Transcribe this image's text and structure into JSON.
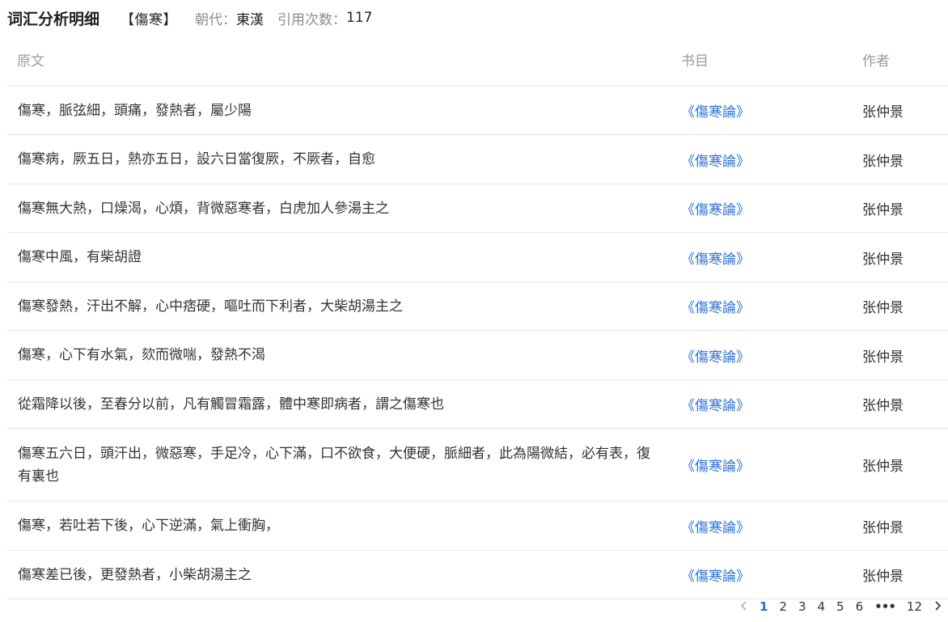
{
  "header": {
    "title": "词汇分析明细",
    "word": "【傷寒】",
    "dynasty_label": "朝代：",
    "dynasty_value": "東漢",
    "citations_label": "引用次数：",
    "citations_value": "117"
  },
  "table": {
    "columns": [
      "原文",
      "书目",
      "作者"
    ],
    "rows": [
      {
        "text": "傷寒，脈弦細，頭痛，發熱者，屬少陽",
        "book": "《傷寒論》",
        "author": "张仲景"
      },
      {
        "text": "傷寒病，厥五日，熱亦五日，設六日當復厥，不厥者，自愈",
        "book": "《傷寒論》",
        "author": "张仲景"
      },
      {
        "text": "傷寒無大熱，口燥渴，心煩，背微惡寒者，白虎加人參湯主之",
        "book": "《傷寒論》",
        "author": "张仲景"
      },
      {
        "text": "傷寒中風，有柴胡證",
        "book": "《傷寒論》",
        "author": "张仲景"
      },
      {
        "text": "傷寒發熱，汗出不解，心中痞硬，嘔吐而下利者，大柴胡湯主之",
        "book": "《傷寒論》",
        "author": "张仲景"
      },
      {
        "text": "傷寒，心下有水氣，欬而微喘，發熱不渴",
        "book": "《傷寒論》",
        "author": "张仲景"
      },
      {
        "text": "從霜降以後，至春分以前，凡有觸冒霜露，體中寒即病者，謂之傷寒也",
        "book": "《傷寒論》",
        "author": "张仲景"
      },
      {
        "text": "傷寒五六日，頭汗出，微惡寒，手足冷，心下滿，口不欲食，大便硬，脈細者，此為陽微結，必有表，復有裏也",
        "book": "《傷寒論》",
        "author": "张仲景"
      },
      {
        "text": "傷寒，若吐若下後，心下逆滿，氣上衝胸，",
        "book": "《傷寒論》",
        "author": "张仲景"
      },
      {
        "text": "傷寒差已後，更發熱者，小柴胡湯主之",
        "book": "《傷寒論》",
        "author": "张仲景"
      }
    ]
  },
  "pagination": {
    "prev_icon": "chevron-left-icon",
    "next_icon": "chevron-right-icon",
    "pages": [
      "1",
      "2",
      "3",
      "4",
      "5",
      "6"
    ],
    "ellipsis": "•••",
    "last_page": "12",
    "current": "1"
  },
  "colors": {
    "link": "#2f72d8",
    "active_page": "#1f6fe0",
    "divider": "#e8e8e8",
    "muted": "#8c8c8c"
  }
}
